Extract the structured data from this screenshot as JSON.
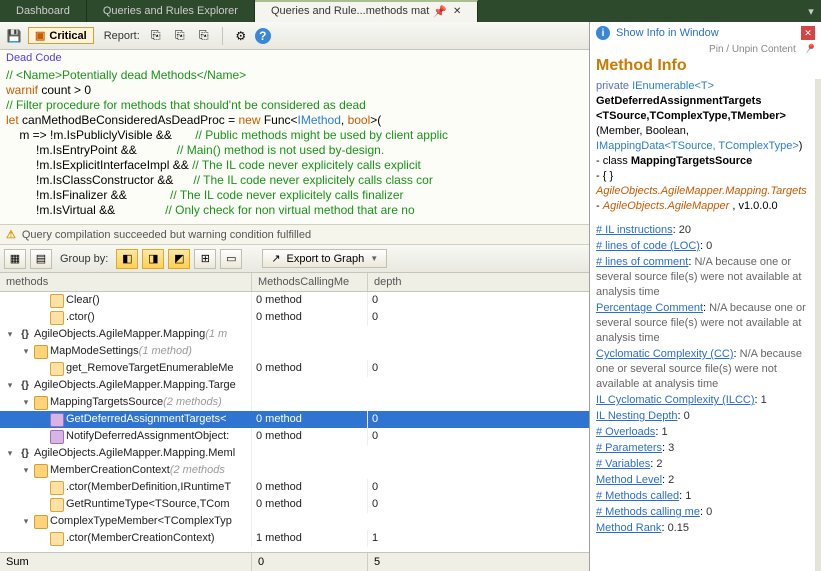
{
  "tabs": {
    "items": [
      {
        "label": "Dashboard",
        "active": false
      },
      {
        "label": "Queries and Rules Explorer",
        "active": false
      },
      {
        "label": "Queries and Rule...methods mat",
        "active": true
      }
    ],
    "pin_glyph": "📌",
    "close_glyph": "✕",
    "menu_glyph": "▾"
  },
  "toolbar": {
    "save_glyph": "💾",
    "critical_icon": "▣",
    "critical_label": "Critical",
    "report_label": "Report:",
    "export_icons": [
      "⎘",
      "⎘",
      "⎘"
    ],
    "gear_glyph": "⚙",
    "help_glyph": "?"
  },
  "editor": {
    "title": "Dead Code",
    "lines": [
      {
        "segs": [
          {
            "cls": "c-comment",
            "t": "// <Name>Potentially dead Methods</Name>"
          }
        ]
      },
      {
        "segs": [
          {
            "cls": "c-key",
            "t": "warnif"
          },
          {
            "cls": "c-text",
            "t": " count > 0"
          }
        ]
      },
      {
        "segs": [
          {
            "cls": "c-comment",
            "t": "// Filter procedure for methods that should'nt be considered as dead"
          }
        ]
      },
      {
        "segs": [
          {
            "cls": "c-key",
            "t": "let"
          },
          {
            "cls": "c-text",
            "t": " canMethodBeConsideredAsDeadProc = "
          },
          {
            "cls": "c-key",
            "t": "new"
          },
          {
            "cls": "c-text",
            "t": " Func<"
          },
          {
            "cls": "c-type",
            "t": "IMethod"
          },
          {
            "cls": "c-text",
            "t": ", "
          },
          {
            "cls": "c-key",
            "t": "bool"
          },
          {
            "cls": "c-text",
            "t": ">("
          }
        ]
      },
      {
        "segs": [
          {
            "cls": "c-text",
            "t": "    m => !m.IsPubliclyVisible &&       "
          },
          {
            "cls": "c-comment",
            "t": "// Public methods might be used by client applic"
          }
        ]
      },
      {
        "segs": [
          {
            "cls": "c-text",
            "t": "         !m.IsEntryPoint &&            "
          },
          {
            "cls": "c-comment",
            "t": "// Main() method is not used by-design."
          }
        ]
      },
      {
        "segs": [
          {
            "cls": "c-text",
            "t": "         !m.IsExplicitInterfaceImpl && "
          },
          {
            "cls": "c-comment",
            "t": "// The IL code never explicitely calls explicit "
          }
        ]
      },
      {
        "segs": [
          {
            "cls": "c-text",
            "t": "         !m.IsClassConstructor &&      "
          },
          {
            "cls": "c-comment",
            "t": "// The IL code never explicitely calls class cor"
          }
        ]
      },
      {
        "segs": [
          {
            "cls": "c-text",
            "t": "         !m.IsFinalizer &&             "
          },
          {
            "cls": "c-comment",
            "t": "// The IL code never explicitely calls finalizer"
          }
        ]
      },
      {
        "segs": [
          {
            "cls": "c-text",
            "t": "         !m.IsVirtual &&               "
          },
          {
            "cls": "c-comment",
            "t": "// Only check for non virtual method that are no"
          }
        ]
      }
    ]
  },
  "warning": {
    "icon": "⚠",
    "text": "Query compilation succeeded but warning condition fulfilled"
  },
  "midbar": {
    "groupby_label": "Group by:",
    "export_label": "Export to Graph",
    "export_icon": "↗"
  },
  "grid": {
    "headers": {
      "col1": "methods",
      "col2": "MethodsCallingMe",
      "col3": "depth"
    },
    "rows": [
      {
        "depth": 2,
        "exp": "",
        "icon": "mthp",
        "label": "Clear()",
        "c2": "0 method",
        "c3": "0"
      },
      {
        "depth": 2,
        "exp": "",
        "icon": "mthp",
        "label": ".ctor()",
        "c2": "0 method",
        "c3": "0"
      },
      {
        "depth": 0,
        "exp": "▾",
        "icon": "ns",
        "label": "AgileObjects.AgileMapper.Mapping",
        "dim": "(1 m",
        "c2": "",
        "c3": ""
      },
      {
        "depth": 1,
        "exp": "▾",
        "icon": "cls",
        "label": "MapModeSettings",
        "dim": "(1 method)",
        "c2": "",
        "c3": ""
      },
      {
        "depth": 2,
        "exp": "",
        "icon": "mthp",
        "label": "get_RemoveTargetEnumerableMe",
        "c2": "0 method",
        "c3": "0"
      },
      {
        "depth": 0,
        "exp": "▾",
        "icon": "ns",
        "label": "AgileObjects.AgileMapper.Mapping.Targe",
        "c2": "",
        "c3": ""
      },
      {
        "depth": 1,
        "exp": "▾",
        "icon": "cls",
        "label": "MappingTargetsSource",
        "dim": "(2 methods)",
        "c2": "",
        "c3": ""
      },
      {
        "depth": 2,
        "exp": "",
        "icon": "mth",
        "label": "GetDeferredAssignmentTargets<",
        "c2": "0 method",
        "c3": "0",
        "selected": true
      },
      {
        "depth": 2,
        "exp": "",
        "icon": "mth",
        "label": "NotifyDeferredAssignmentObject:",
        "c2": "0 method",
        "c3": "0"
      },
      {
        "depth": 0,
        "exp": "▾",
        "icon": "ns",
        "label": "AgileObjects.AgileMapper.Mapping.Meml",
        "c2": "",
        "c3": ""
      },
      {
        "depth": 1,
        "exp": "▾",
        "icon": "cls",
        "label": "MemberCreationContext",
        "dim": "(2 methods",
        "c2": "",
        "c3": ""
      },
      {
        "depth": 2,
        "exp": "",
        "icon": "mthp",
        "label": ".ctor(MemberDefinition,IRuntimeT",
        "c2": "0 method",
        "c3": "0"
      },
      {
        "depth": 2,
        "exp": "",
        "icon": "mthp",
        "label": "GetRuntimeType<TSource,TCom",
        "c2": "0 method",
        "c3": "0"
      },
      {
        "depth": 1,
        "exp": "▾",
        "icon": "cls",
        "label": "ComplexTypeMember<TComplexTyp",
        "c2": "",
        "c3": ""
      },
      {
        "depth": 2,
        "exp": "",
        "icon": "mthp",
        "label": ".ctor(MemberCreationContext)",
        "c2": "1 method",
        "c3": "1"
      }
    ],
    "sum": {
      "label": "Sum",
      "c2": "0",
      "c3": "5"
    }
  },
  "info": {
    "link": "Show Info in Window",
    "pin_label": "Pin / Unpin Content",
    "heading": "Method Info",
    "sig_private": "private",
    "sig_return": "IEnumerable<T>",
    "sig_name": "GetDeferredAssignmentTargets",
    "sig_generics": "<TSource,TComplexType,TMember>",
    "sig_params": "(Member, Boolean, IMappingData<TSource, TComplexType>)",
    "class_prefix": "- class ",
    "class_name": "MappingTargetsSource",
    "ns_prefix": "- { }",
    "ns_name": "AgileObjects.AgileMapper.Mapping.Targets",
    "asm_prefix": "- ",
    "asm_name": "AgileObjects.AgileMapper",
    "asm_ver": ", v1.0.0.0",
    "metrics": [
      {
        "label": "# IL instructions",
        "value": "20"
      },
      {
        "label": "# lines of code (LOC)",
        "value": "0"
      },
      {
        "label": "# lines of comment",
        "value": "N/A because one or several source file(s) were not available at analysis time",
        "long": true
      },
      {
        "label": "Percentage Comment",
        "value": "N/A because one or several source file(s) were not available at analysis time",
        "long": true
      },
      {
        "label": "Cyclomatic Complexity (CC)",
        "value": "N/A because one or several source file(s) were not available at analysis time",
        "long": true
      },
      {
        "label": "IL Cyclomatic Complexity (ILCC)",
        "value": "1"
      },
      {
        "label": "IL Nesting Depth",
        "value": "0"
      },
      {
        "label": "# Overloads",
        "value": "1"
      },
      {
        "label": "# Parameters",
        "value": "3"
      },
      {
        "label": "# Variables",
        "value": "2"
      },
      {
        "label": "Method Level",
        "value": "2"
      },
      {
        "label": "# Methods called",
        "value": "1"
      },
      {
        "label": "# Methods calling me",
        "value": "0"
      },
      {
        "label": "Method Rank",
        "value": "0.15"
      }
    ]
  }
}
